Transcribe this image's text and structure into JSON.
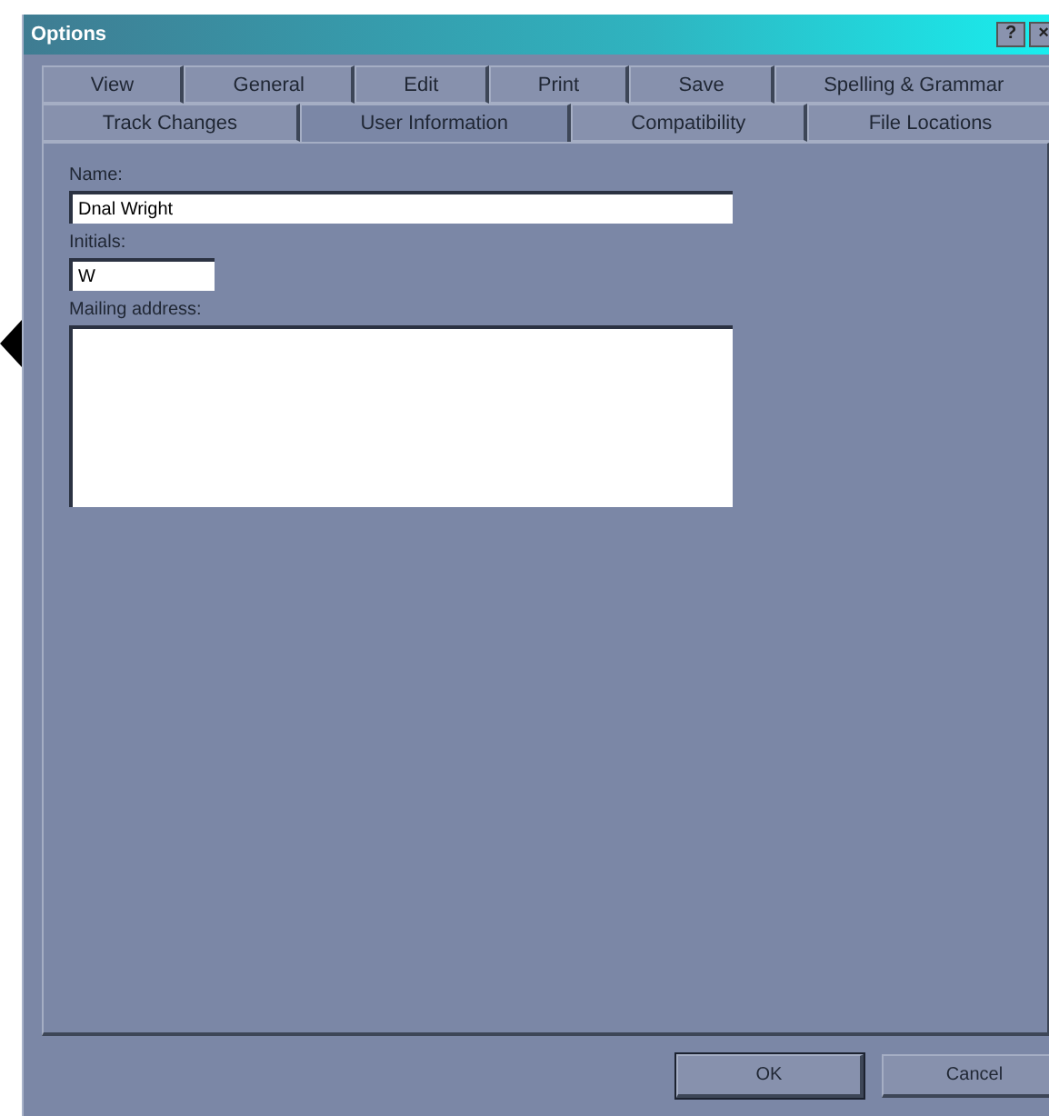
{
  "window": {
    "title": "Options",
    "help": "?",
    "close": "×"
  },
  "tab_rows": [
    [
      {
        "label": "View",
        "selected": false
      },
      {
        "label": "General",
        "selected": false
      },
      {
        "label": "Edit",
        "selected": false
      },
      {
        "label": "Print",
        "selected": false
      },
      {
        "label": "Save",
        "selected": false
      },
      {
        "label": "Spelling & Grammar",
        "selected": false
      }
    ],
    [
      {
        "label": "Track Changes",
        "selected": false
      },
      {
        "label": "User Information",
        "selected": true
      },
      {
        "label": "Compatibility",
        "selected": false
      },
      {
        "label": "File Locations",
        "selected": false
      }
    ]
  ],
  "fields": [
    {
      "label": "Name:",
      "value": "Dnal Wright",
      "kind": "wide"
    },
    {
      "label": "Initials:",
      "value": "W",
      "kind": "short"
    },
    {
      "label": "Mailing address:",
      "kind": "area"
    }
  ],
  "buttons": [
    {
      "label": "OK",
      "default": true
    },
    {
      "label": "Cancel",
      "default": false
    }
  ]
}
